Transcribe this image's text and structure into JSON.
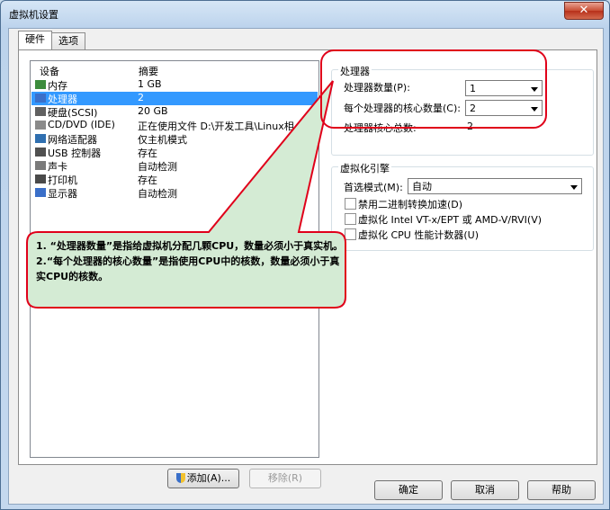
{
  "window": {
    "title": "虚拟机设置",
    "close_label": "✕"
  },
  "tabs": [
    {
      "label": "硬件"
    },
    {
      "label": "选项"
    }
  ],
  "device_list": {
    "col_device": "设备",
    "col_summary": "摘要",
    "rows": [
      {
        "name": "内存",
        "summary": "1 GB",
        "icon": "memory-icon"
      },
      {
        "name": "处理器",
        "summary": "2",
        "icon": "processor-icon"
      },
      {
        "name": "硬盘(SCSI)",
        "summary": "20 GB",
        "icon": "hard-disk-icon"
      },
      {
        "name": "CD/DVD (IDE)",
        "summary": "正在使用文件 D:\\开发工具\\Linux相...",
        "icon": "cd-dvd-icon"
      },
      {
        "name": "网络适配器",
        "summary": "仅主机模式",
        "icon": "network-adapter-icon"
      },
      {
        "name": "USB 控制器",
        "summary": "存在",
        "icon": "usb-icon"
      },
      {
        "name": "声卡",
        "summary": "自动检测",
        "icon": "sound-card-icon"
      },
      {
        "name": "打印机",
        "summary": "存在",
        "icon": "printer-icon"
      },
      {
        "name": "显示器",
        "summary": "自动检测",
        "icon": "display-icon"
      }
    ],
    "add_button": "添加(A)...",
    "remove_button": "移除(R)"
  },
  "processor": {
    "group_label": "处理器",
    "count_label": "处理器数量(P):",
    "count_value": "1",
    "cores_label": "每个处理器的核心数量(C):",
    "cores_value": "2",
    "total_label": "处理器核心总数:",
    "total_value": "2"
  },
  "virtualization": {
    "group_label": "虚拟化引擎",
    "mode_label": "首选模式(M):",
    "mode_value": "自动",
    "options": [
      {
        "label": "禁用二进制转换加速(D)",
        "checked": false
      },
      {
        "label": "虚拟化 Intel VT-x/EPT 或 AMD-V/RVI(V)",
        "checked": false
      },
      {
        "label": "虚拟化 CPU 性能计数器(U)",
        "checked": false
      }
    ]
  },
  "callout": {
    "line1": "1. “处理器数量”是指给虚拟机分配几颗CPU，数量必须小于真实机。",
    "line2": "2.“每个处理器的核心数量”是指使用CPU中的核数，数量必须小于真实CPU的核数。"
  },
  "footer": {
    "ok": "确定",
    "cancel": "取消",
    "help": "帮助"
  },
  "colors": {
    "selection": "#3399ff",
    "callout_fill": "#d4ebd4",
    "callout_border": "#e0001a"
  }
}
